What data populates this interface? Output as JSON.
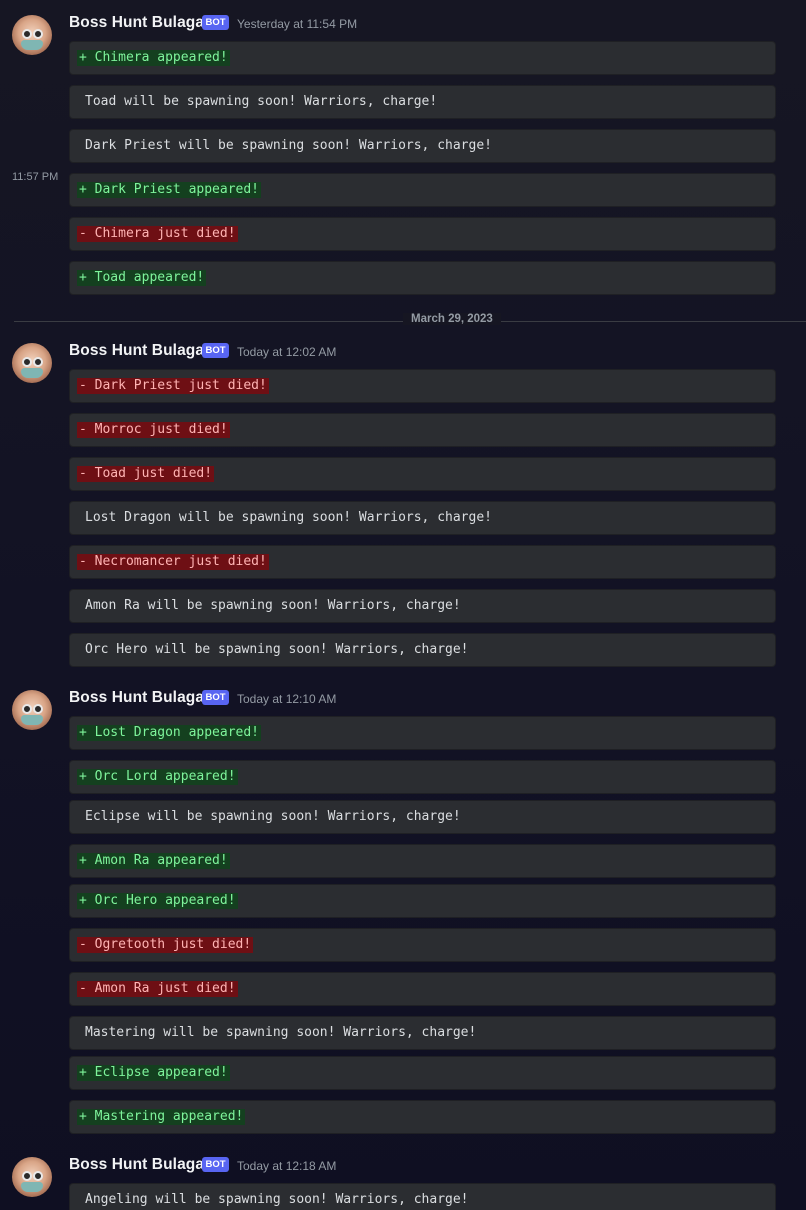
{
  "colors": {
    "add_text": "#7ef49b",
    "add_bg": "#14401f",
    "del_text": "#ffb3b3",
    "del_bg": "#6e0f14",
    "bot_badge": "#5865f2"
  },
  "groups": [
    {
      "author": "Boss Hunt Bulagan",
      "badge": "BOT",
      "timestamp": "Yesterday at 11:54 PM",
      "messages": [
        {
          "kind": "add",
          "text": "+ Chimera appeared!"
        },
        {
          "kind": "plain",
          "text": "Toad will be spawning soon! Warriors, charge!"
        },
        {
          "kind": "plain",
          "text": "Dark Priest will be spawning soon! Warriors, charge!"
        },
        {
          "kind": "add",
          "text": "+ Dark Priest appeared!",
          "side_time": "11:57 PM"
        },
        {
          "kind": "del",
          "text": "- Chimera just died!"
        },
        {
          "kind": "add",
          "text": "+ Toad appeared!"
        }
      ]
    },
    {
      "author": "Boss Hunt Bulagan",
      "badge": "BOT",
      "timestamp": "Today at 12:02 AM",
      "messages": [
        {
          "kind": "del",
          "text": "- Dark Priest just died!"
        },
        {
          "kind": "del",
          "text": "- Morroc just died!"
        },
        {
          "kind": "del",
          "text": "- Toad just died!"
        },
        {
          "kind": "plain",
          "text": "Lost Dragon will be spawning soon! Warriors, charge!"
        },
        {
          "kind": "del",
          "text": "- Necromancer just died!"
        },
        {
          "kind": "plain",
          "text": "Amon Ra will be spawning soon! Warriors, charge!"
        },
        {
          "kind": "plain",
          "text": "Orc Hero will be spawning soon! Warriors, charge!"
        }
      ]
    },
    {
      "author": "Boss Hunt Bulagan",
      "badge": "BOT",
      "timestamp": "Today at 12:10 AM",
      "messages": [
        {
          "kind": "add",
          "text": "+ Lost Dragon appeared!"
        },
        {
          "kind": "add",
          "text": "+ Orc Lord appeared!"
        },
        {
          "kind": "plain",
          "text": "Eclipse will be spawning soon! Warriors, charge!"
        },
        {
          "kind": "add",
          "text": "+ Amon Ra appeared!"
        },
        {
          "kind": "add",
          "text": "+ Orc Hero appeared!"
        },
        {
          "kind": "del",
          "text": "- Ogretooth just died!"
        },
        {
          "kind": "del",
          "text": "- Amon Ra just died!"
        },
        {
          "kind": "plain",
          "text": "Mastering will be spawning soon! Warriors, charge!"
        },
        {
          "kind": "add",
          "text": "+ Eclipse appeared!"
        },
        {
          "kind": "add",
          "text": "+ Mastering appeared!"
        }
      ]
    },
    {
      "author": "Boss Hunt Bulagan",
      "badge": "BOT",
      "timestamp": "Today at 12:18 AM",
      "messages": [
        {
          "kind": "plain",
          "text": "Angeling will be spawning soon! Warriors, charge!"
        }
      ]
    }
  ],
  "date_divider": "March 29, 2023"
}
